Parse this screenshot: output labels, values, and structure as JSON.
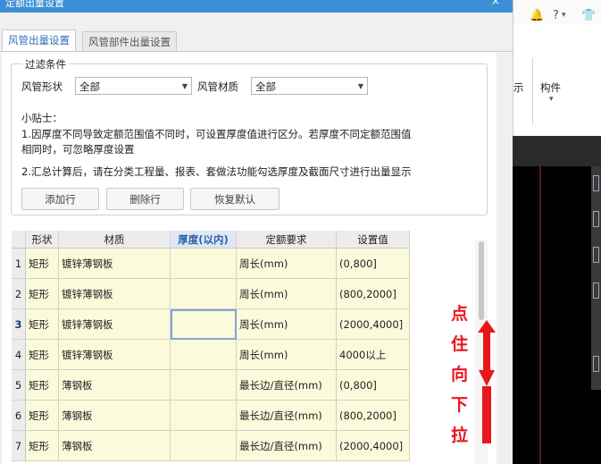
{
  "dialog": {
    "title": "定额出量设置",
    "close": "×"
  },
  "tabs": [
    {
      "label": "风管出量设置",
      "active": true
    },
    {
      "label": "风管部件出量设置",
      "active": false
    }
  ],
  "filter": {
    "legend": "过滤条件",
    "shape_label": "风管形状",
    "shape_value": "全部",
    "material_label": "风管材质",
    "material_value": "全部"
  },
  "tips": {
    "heading": "小贴士：",
    "line1": "1.因厚度不同导致定额范围值不同时，可设置厚度值进行区分。若厚度不同定额范围值",
    "line2": "相同时，可忽略厚度设置",
    "line3": "2.汇总计算后，请在分类工程量、报表、套做法功能勾选厚度及截面尺寸进行出量显示"
  },
  "buttons": {
    "add": "添加行",
    "delete": "删除行",
    "reset": "恢复默认"
  },
  "grid": {
    "columns": [
      "形状",
      "材质",
      "厚度(以内)",
      "定额要求",
      "设置值"
    ],
    "selected_column": 2,
    "current_row": 3,
    "rows": [
      {
        "num": "1",
        "shape": "矩形",
        "material": "镀锌薄钢板",
        "thickness": "",
        "requirement": "周长(mm)",
        "value": "(0,800]"
      },
      {
        "num": "2",
        "shape": "矩形",
        "material": "镀锌薄钢板",
        "thickness": "",
        "requirement": "周长(mm)",
        "value": "(800,2000]"
      },
      {
        "num": "3",
        "shape": "矩形",
        "material": "镀锌薄钢板",
        "thickness": "",
        "requirement": "周长(mm)",
        "value": "(2000,4000]"
      },
      {
        "num": "4",
        "shape": "矩形",
        "material": "镀锌薄钢板",
        "thickness": "",
        "requirement": "周长(mm)",
        "value": "4000以上"
      },
      {
        "num": "5",
        "shape": "矩形",
        "material": "薄钢板",
        "thickness": "",
        "requirement": "最长边/直径(mm)",
        "value": "(0,800]"
      },
      {
        "num": "6",
        "shape": "矩形",
        "material": "薄钢板",
        "thickness": "",
        "requirement": "最长边/直径(mm)",
        "value": "(800,2000]"
      },
      {
        "num": "7",
        "shape": "矩形",
        "material": "薄钢板",
        "thickness": "",
        "requirement": "最长边/直径(mm)",
        "value": "(2000,4000]"
      }
    ]
  },
  "annotation": {
    "chars": [
      "点",
      "住",
      "向",
      "下",
      "拉"
    ],
    "color": "#e8171b"
  },
  "app_right": {
    "top_icons": [
      "bell-icon",
      "help-icon",
      "shirt-icon"
    ],
    "help_text": "?",
    "ribbon_partial_label": "示",
    "ribbon_label": "构件",
    "ribbon_arrow": "▾"
  },
  "colors": {
    "titlebar": "#3c8fd6",
    "cell_bg": "#fbfbdc",
    "accent_tab": "#2d6fb5"
  }
}
